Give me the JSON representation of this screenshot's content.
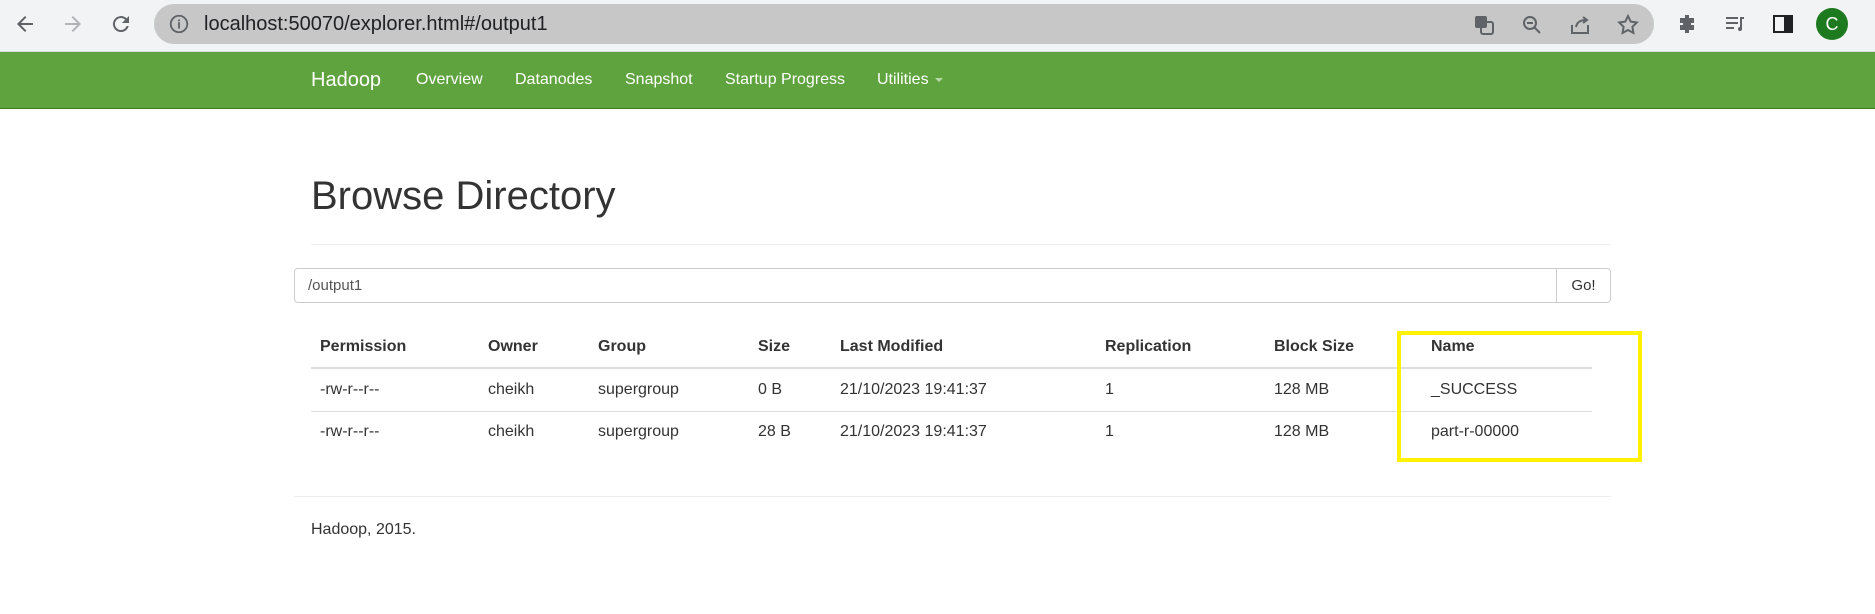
{
  "browser": {
    "url": "localhost:50070/explorer.html#/output1",
    "profile_initial": "C"
  },
  "navbar": {
    "brand": "Hadoop",
    "items": [
      "Overview",
      "Datanodes",
      "Snapshot",
      "Startup Progress",
      "Utilities"
    ]
  },
  "page": {
    "title": "Browse Directory",
    "path_value": "/output1",
    "go_label": "Go!"
  },
  "table": {
    "headers": [
      "Permission",
      "Owner",
      "Group",
      "Size",
      "Last Modified",
      "Replication",
      "Block Size",
      "Name"
    ],
    "rows": [
      [
        "-rw-r--r--",
        "cheikh",
        "supergroup",
        "0 B",
        "21/10/2023 19:41:37",
        "1",
        "128 MB",
        "_SUCCESS"
      ],
      [
        "-rw-r--r--",
        "cheikh",
        "supergroup",
        "28 B",
        "21/10/2023 19:41:37",
        "1",
        "128 MB",
        "part-r-00000"
      ]
    ]
  },
  "footer": {
    "text": "Hadoop, 2015."
  },
  "colors": {
    "navbar": "#5fa33e",
    "link": "#337ab7",
    "highlight": "#fff200"
  }
}
